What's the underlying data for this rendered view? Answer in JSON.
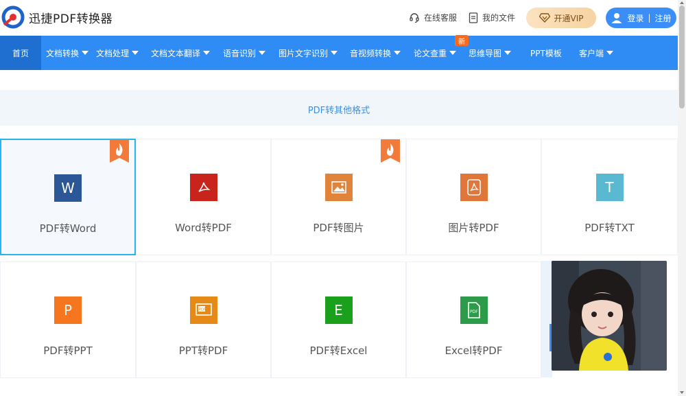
{
  "header": {
    "brand": "迅捷PDF转换器",
    "support": "在线客服",
    "my_files": "我的文件",
    "vip": "开通VIP",
    "login": "登录",
    "register": "注册"
  },
  "nav": {
    "items": [
      {
        "label": "首页",
        "dropdown": false,
        "active": true
      },
      {
        "label": "文档转换",
        "dropdown": true
      },
      {
        "label": "文档处理",
        "dropdown": true
      },
      {
        "label": "文档文本翻译",
        "dropdown": true
      },
      {
        "label": "语音识别",
        "dropdown": true
      },
      {
        "label": "图片文字识别",
        "dropdown": true
      },
      {
        "label": "音视频转换",
        "dropdown": true
      },
      {
        "label": "论文查重",
        "dropdown": true
      },
      {
        "label": "思维导图",
        "dropdown": true
      },
      {
        "label": "PPT模板",
        "dropdown": false
      },
      {
        "label": "客户端",
        "dropdown": true
      }
    ],
    "new_badge": "新"
  },
  "section": {
    "title": "PDF转其他格式"
  },
  "tools": [
    {
      "label": "PDF转Word",
      "icon": "word-icon",
      "glyph": "W",
      "color": "#2b5797",
      "hot": true,
      "selected": true
    },
    {
      "label": "Word转PDF",
      "icon": "pdf-icon",
      "glyph": "",
      "color": "#c9241c",
      "hot": false
    },
    {
      "label": "PDF转图片",
      "icon": "image-icon",
      "glyph": "",
      "color": "#e0833b",
      "hot": true
    },
    {
      "label": "图片转PDF",
      "icon": "pdf-doc-icon",
      "glyph": "",
      "color": "#e0763a",
      "hot": false
    },
    {
      "label": "PDF转TXT",
      "icon": "txt-icon",
      "glyph": "T",
      "color": "#5ab8d0",
      "hot": false
    },
    {
      "label": "PDF转PPT",
      "icon": "ppt-icon",
      "glyph": "P",
      "color": "#f5761e",
      "hot": false
    },
    {
      "label": "PPT转PDF",
      "icon": "ppt-pdf-icon",
      "glyph": "",
      "color": "#e58a16",
      "hot": false
    },
    {
      "label": "PDF转Excel",
      "icon": "excel-icon",
      "glyph": "E",
      "color": "#1aa01a",
      "hot": false
    },
    {
      "label": "Excel转PDF",
      "icon": "excel-pdf-icon",
      "glyph": "",
      "color": "#2e9b4a",
      "hot": false
    }
  ],
  "colors": {
    "nav": "#2f8cf5",
    "accent": "#29b3f0",
    "section_text": "#3d8fe0"
  }
}
